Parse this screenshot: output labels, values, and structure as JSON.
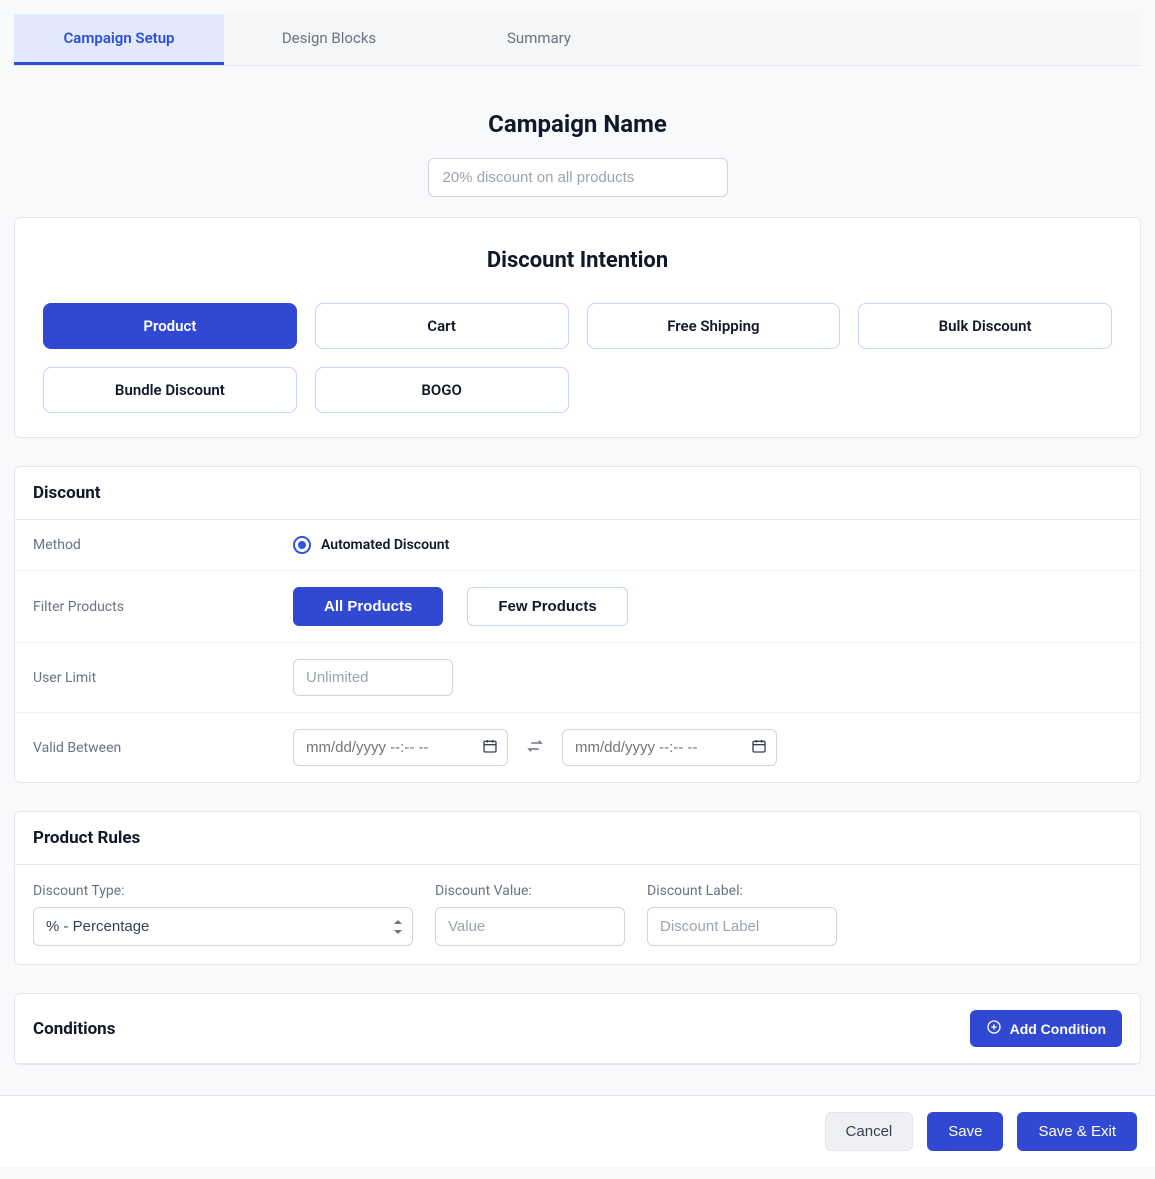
{
  "tabs": {
    "setup": "Campaign Setup",
    "design": "Design Blocks",
    "summary": "Summary"
  },
  "campaign": {
    "title": "Campaign Name",
    "placeholder": "20% discount on all products"
  },
  "intention": {
    "title": "Discount Intention",
    "options": {
      "product": "Product",
      "cart": "Cart",
      "free_shipping": "Free Shipping",
      "bulk": "Bulk Discount",
      "bundle": "Bundle Discount",
      "bogo": "BOGO"
    }
  },
  "discount": {
    "header": "Discount",
    "method_label": "Method",
    "method_value": "Automated Discount",
    "filter_label": "Filter Products",
    "filter_all": "All Products",
    "filter_few": "Few Products",
    "user_limit_label": "User Limit",
    "user_limit_placeholder": "Unlimited",
    "valid_label": "Valid Between",
    "date_placeholder": "mm/dd/yyyy --:-- --"
  },
  "rules": {
    "header": "Product Rules",
    "type_label": "Discount Type:",
    "type_value": "% - Percentage",
    "value_label": "Discount Value:",
    "value_placeholder": "Value",
    "label_label": "Discount Label:",
    "label_placeholder": "Discount Label"
  },
  "conditions": {
    "header": "Conditions",
    "add": "Add Condition"
  },
  "footer": {
    "cancel": "Cancel",
    "save": "Save",
    "save_exit": "Save & Exit"
  }
}
